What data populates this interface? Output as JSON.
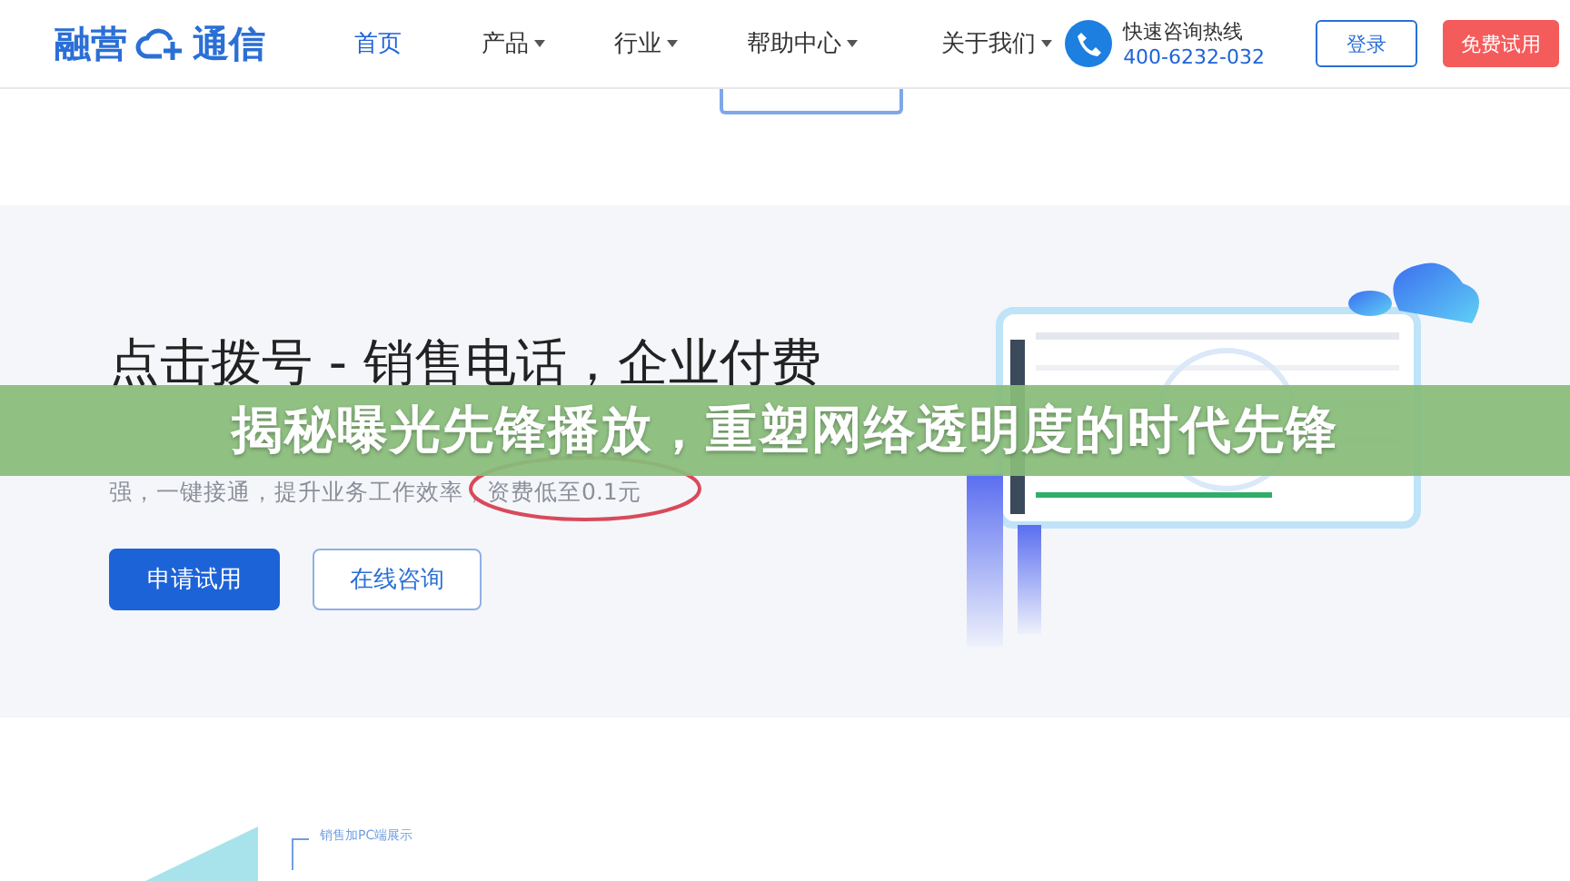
{
  "header": {
    "logo": {
      "left": "融营",
      "right": "通信"
    },
    "nav": [
      {
        "label": "首页",
        "selected": true,
        "has_menu": false
      },
      {
        "label": "产品",
        "selected": false,
        "has_menu": true
      },
      {
        "label": "行业",
        "selected": false,
        "has_menu": true
      },
      {
        "label": "帮助中心",
        "selected": false,
        "has_menu": true
      },
      {
        "label": "关于我们",
        "selected": false,
        "has_menu": true
      }
    ],
    "hotline": {
      "label": "快速咨询热线",
      "number": "400-6232-032"
    },
    "buttons": [
      {
        "label": "登录",
        "kind": "outline"
      },
      {
        "label": "免费试用",
        "kind": "solid"
      }
    ]
  },
  "hero": {
    "title": "点击拨号 - 销售电话，企业付费",
    "subtitle_line_2": "强，一键接通，提升业务工作效率，资费低至0.1元",
    "buttons": [
      {
        "label": "申请试用",
        "kind": "solid"
      },
      {
        "label": "在线咨询",
        "kind": "outline"
      }
    ]
  },
  "feature": {
    "callout": "销售加PC端展示"
  },
  "overlay_banner": {
    "title": "揭秘曝光先锋播放，重塑网络透明度的时代先锋"
  }
}
